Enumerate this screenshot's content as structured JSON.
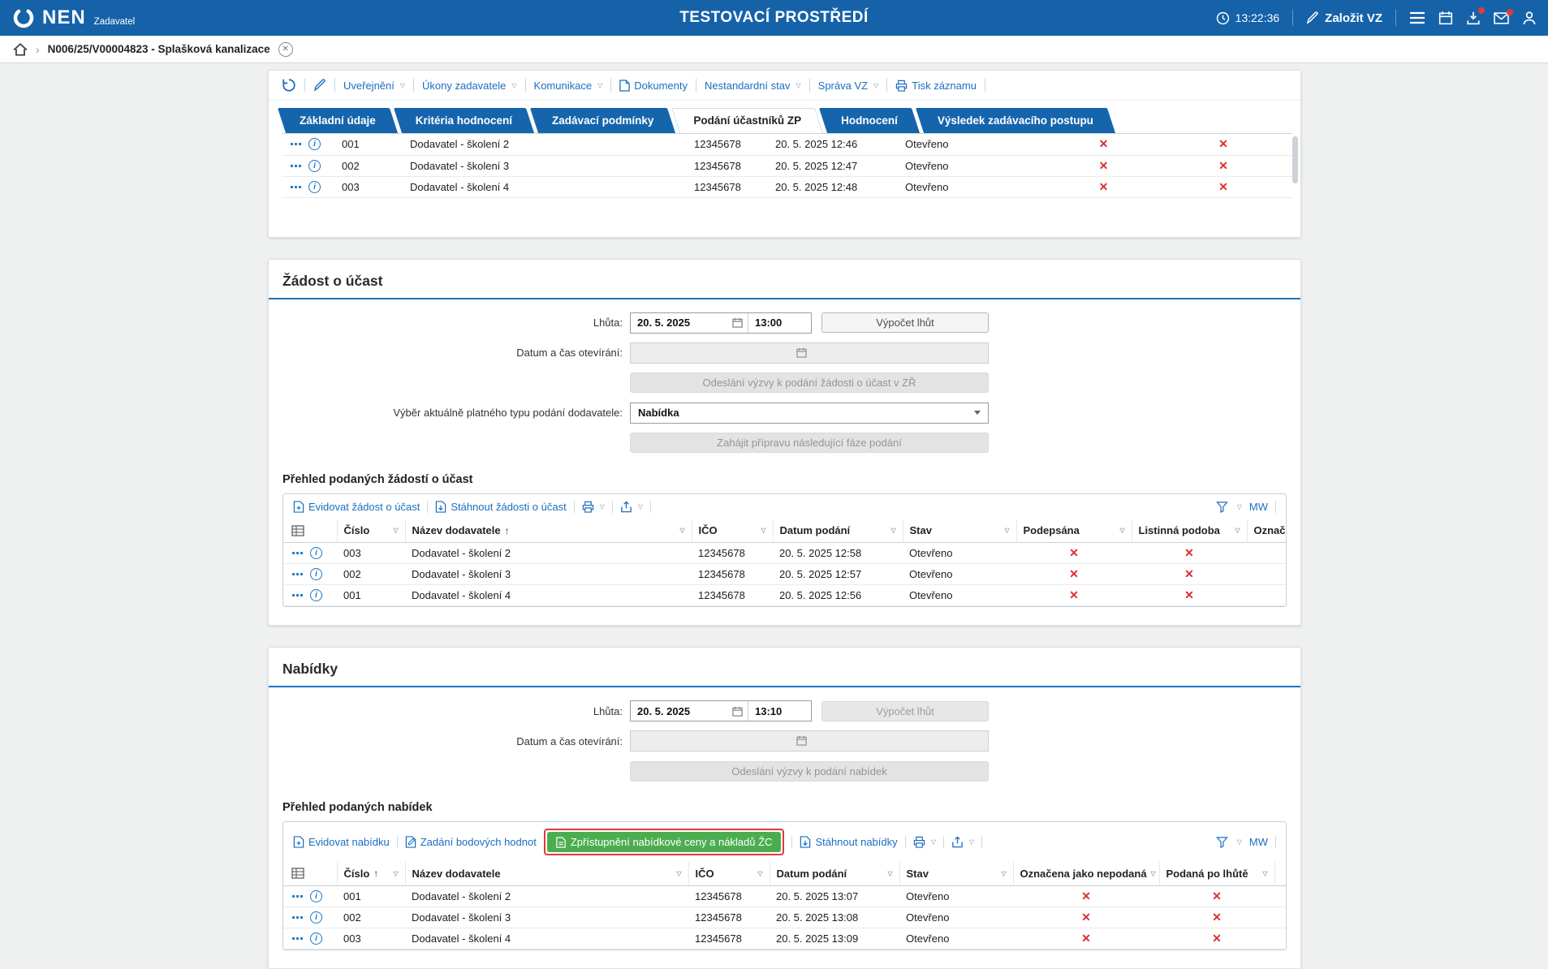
{
  "header": {
    "brand": "NEN",
    "brand_subtitle": "Zadavatel",
    "environment_title": "TESTOVACÍ PROSTŘEDÍ",
    "time": "13:22:36",
    "create_vz_label": "Založit VZ"
  },
  "breadcrumb": {
    "record_label": "N006/25/V00004823 - Splašková kanalizace"
  },
  "record_toolbar": {
    "uverejneni": "Uveřejnění",
    "ukony": "Úkony zadavatele",
    "komunikace": "Komunikace",
    "dokumenty": "Dokumenty",
    "nestandardni": "Nestandardní stav",
    "sprava": "Správa VZ",
    "tisk": "Tisk záznamu"
  },
  "tabs": [
    "Základní údaje",
    "Kritéria hodnocení",
    "Zadávací podmínky",
    "Podání účastníků ZP",
    "Hodnocení",
    "Výsledek zadávacího postupu"
  ],
  "participants": {
    "rows": [
      {
        "num": "001",
        "supplier": "Dodavatel - školení 2",
        "ico": "12345678",
        "submitted": "20. 5. 2025 12:46",
        "status": "Otevřeno"
      },
      {
        "num": "002",
        "supplier": "Dodavatel - školení 3",
        "ico": "12345678",
        "submitted": "20. 5. 2025 12:47",
        "status": "Otevřeno"
      },
      {
        "num": "003",
        "supplier": "Dodavatel - školení 4",
        "ico": "12345678",
        "submitted": "20. 5. 2025 12:48",
        "status": "Otevřeno"
      }
    ]
  },
  "zadost": {
    "title": "Žádost o účast",
    "lhuta_label": "Lhůta:",
    "lhuta_date": "20. 5. 2025",
    "lhuta_time": "13:00",
    "vypocet_btn": "Výpočet lhůt",
    "oteviraci_label": "Datum a čas otevírání:",
    "odeslani_btn": "Odeslání výzvy k podání žádosti o účast v ZŘ",
    "typ_label": "Výběr aktuálně platného typu podání dodavatele:",
    "typ_value": "Nabídka",
    "zahajit_btn": "Zahájit přípravu následující fáze podání",
    "grid_title": "Přehled podaných žádostí o účast",
    "grid": {
      "action1": "Evidovat žádost o účast",
      "action2": "Stáhnout žádosti o účast",
      "mw": "MW",
      "col_cislo": "Číslo",
      "col_nazev": "Název dodavatele",
      "col_ico": "IČO",
      "col_datum": "Datum podání",
      "col_stav": "Stav",
      "col_podepsana": "Podepsána",
      "col_listinna": "Listinná podoba",
      "col_oznac": "Označ",
      "rows": [
        {
          "num": "003",
          "supplier": "Dodavatel - školení 2",
          "ico": "12345678",
          "submitted": "20. 5. 2025 12:58",
          "status": "Otevřeno"
        },
        {
          "num": "002",
          "supplier": "Dodavatel - školení 3",
          "ico": "12345678",
          "submitted": "20. 5. 2025 12:57",
          "status": "Otevřeno"
        },
        {
          "num": "001",
          "supplier": "Dodavatel - školení 4",
          "ico": "12345678",
          "submitted": "20. 5. 2025 12:56",
          "status": "Otevřeno"
        }
      ]
    }
  },
  "nabidky": {
    "title": "Nabídky",
    "lhuta_label": "Lhůta:",
    "lhuta_date": "20. 5. 2025",
    "lhuta_time": "13:10",
    "vypocet_btn": "Výpočet lhůt",
    "oteviraci_label": "Datum a čas otevírání:",
    "odeslani_btn": "Odeslání výzvy k podání nabídek",
    "grid_title": "Přehled podaných nabídek",
    "grid": {
      "action1": "Evidovat nabídku",
      "action2": "Zadání bodových hodnot",
      "highlight_btn": "Zpřístupnění nabídkové ceny a nákladů ŽC",
      "action3": "Stáhnout nabídky",
      "mw": "MW",
      "col_cislo": "Číslo",
      "col_nazev": "Název dodavatele",
      "col_ico": "IČO",
      "col_datum": "Datum podání",
      "col_stav": "Stav",
      "col_nepodana": "Označena jako nepodaná",
      "col_lhuta": "Podaná po lhůtě",
      "rows": [
        {
          "num": "001",
          "supplier": "Dodavatel - školení 2",
          "ico": "12345678",
          "submitted": "20. 5. 2025 13:07",
          "status": "Otevřeno"
        },
        {
          "num": "002",
          "supplier": "Dodavatel - školení 3",
          "ico": "12345678",
          "submitted": "20. 5. 2025 13:08",
          "status": "Otevřeno"
        },
        {
          "num": "003",
          "supplier": "Dodavatel - školení 4",
          "ico": "12345678",
          "submitted": "20. 5. 2025 13:09",
          "status": "Otevřeno"
        }
      ]
    }
  },
  "colors": {
    "header_blue": "#1562a9",
    "tab_blue": "#1565ad",
    "link_blue": "#1a6fc0",
    "underline_blue": "#1a72c2",
    "x_red": "#da2f2f",
    "green_button": "#4cad50",
    "annotation_red": "#e03a3a"
  }
}
